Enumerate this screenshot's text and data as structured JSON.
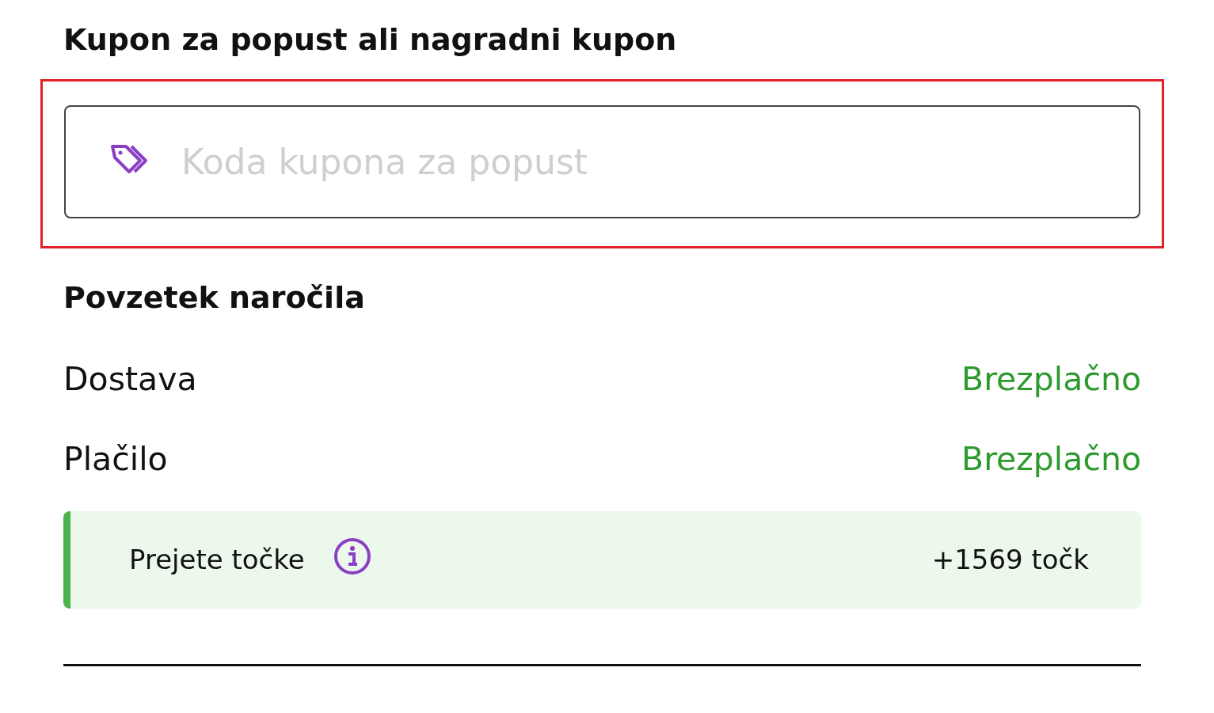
{
  "coupon": {
    "title": "Kupon za popust ali nagradni kupon",
    "highlighted": true,
    "placeholder": "Koda kupona za popust"
  },
  "summary": {
    "title": "Povzetek naročila",
    "rows": [
      {
        "label": "Dostava",
        "value": "Brezplačno"
      },
      {
        "label": "Plačilo",
        "value": "Brezplačno"
      }
    ],
    "points": {
      "label": "Prejete točke",
      "value": "+1569 točk"
    }
  }
}
